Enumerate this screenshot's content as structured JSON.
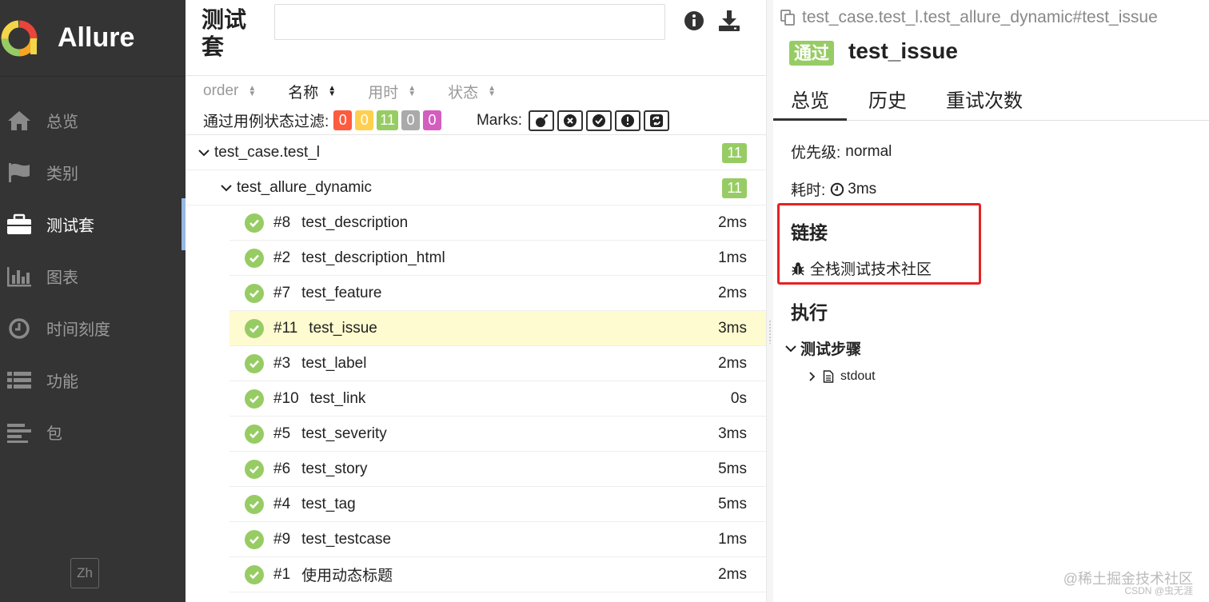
{
  "brand": {
    "name": "Allure"
  },
  "sidebar": {
    "items": [
      {
        "label": "总览",
        "icon": "home-icon"
      },
      {
        "label": "类别",
        "icon": "flag-icon"
      },
      {
        "label": "测试套",
        "icon": "briefcase-icon",
        "active": true
      },
      {
        "label": "图表",
        "icon": "bar-chart-icon"
      },
      {
        "label": "时间刻度",
        "icon": "clock-icon"
      },
      {
        "label": "功能",
        "icon": "list-icon"
      },
      {
        "label": "包",
        "icon": "align-left-icon"
      }
    ],
    "lang": "Zh"
  },
  "suites": {
    "title": "测试套",
    "search_placeholder": "",
    "sort": {
      "order": "order",
      "name": "名称",
      "duration": "用时",
      "status": "状态"
    },
    "filter_label": "通过用例状态过滤:",
    "status_counts": [
      {
        "value": "0",
        "color": "#fd5a3e"
      },
      {
        "value": "0",
        "color": "#ffd050"
      },
      {
        "value": "11",
        "color": "#97cc64"
      },
      {
        "value": "0",
        "color": "#aaaaaa"
      },
      {
        "value": "0",
        "color": "#d35ebe"
      }
    ],
    "marks_label": "Marks:",
    "group1": {
      "name": "test_case.test_l",
      "count": "11"
    },
    "group2": {
      "name": "test_allure_dynamic",
      "count": "11"
    },
    "cases": [
      {
        "num": "#8",
        "name": "test_description",
        "dur": "2ms"
      },
      {
        "num": "#2",
        "name": "test_description_html",
        "dur": "1ms"
      },
      {
        "num": "#7",
        "name": "test_feature",
        "dur": "2ms"
      },
      {
        "num": "#11",
        "name": "test_issue",
        "dur": "3ms",
        "selected": true
      },
      {
        "num": "#3",
        "name": "test_label",
        "dur": "2ms"
      },
      {
        "num": "#10",
        "name": "test_link",
        "dur": "0s"
      },
      {
        "num": "#5",
        "name": "test_severity",
        "dur": "3ms"
      },
      {
        "num": "#6",
        "name": "test_story",
        "dur": "5ms"
      },
      {
        "num": "#4",
        "name": "test_tag",
        "dur": "5ms"
      },
      {
        "num": "#9",
        "name": "test_testcase",
        "dur": "1ms"
      },
      {
        "num": "#1",
        "name": "使用动态标题",
        "dur": "2ms"
      }
    ]
  },
  "detail": {
    "path": "test_case.test_l.test_allure_dynamic#test_issue",
    "status": "通过",
    "title": "test_issue",
    "tabs": [
      "总览",
      "历史",
      "重试次数"
    ],
    "severity_label": "优先级:",
    "severity_value": "normal",
    "duration_label": "耗时:",
    "duration_value": "3ms",
    "links_title": "链接",
    "link_text": "全栈测试技术社区",
    "exec_title": "执行",
    "steps_label": "测试步骤",
    "attachment": "stdout"
  },
  "watermark": {
    "main": "@稀土掘金技术社区",
    "sub": "CSDN @虫无涯"
  },
  "colors": {
    "sidebar": "#343434",
    "passed": "#97cc64",
    "selected_row": "#fffbd0",
    "highlight": "#e52222"
  }
}
